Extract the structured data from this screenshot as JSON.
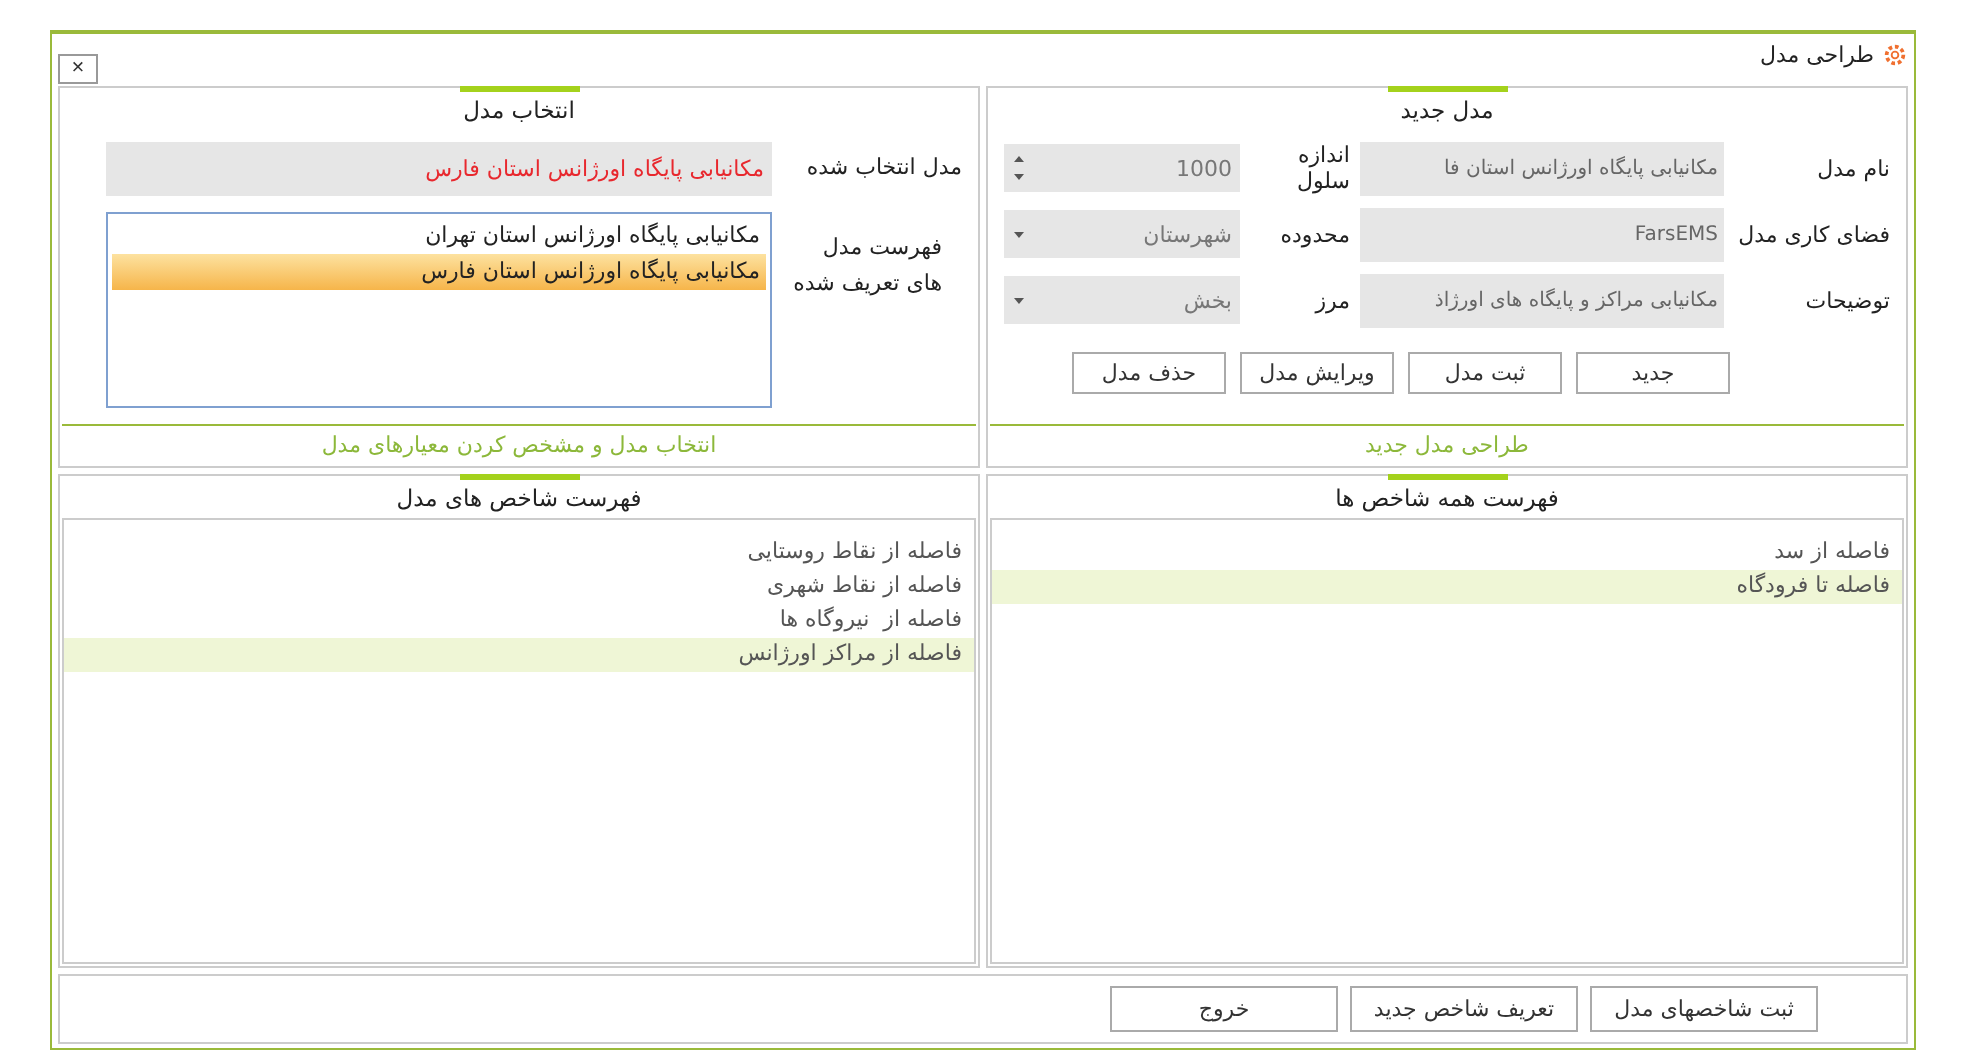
{
  "window": {
    "title": "طراحی مدل",
    "close": "×"
  },
  "new_model": {
    "title": "مدل جدید",
    "footer": "طراحی مدل جدید",
    "fields": [
      {
        "label": "نام مدل",
        "kind": "text",
        "value": "مکانیابی پایگاه اورژانس استان فا"
      },
      {
        "label": "اندازه سلول",
        "kind": "spinner",
        "value": "1000"
      },
      {
        "label": "فضای کاری مدل",
        "kind": "text",
        "value": "FarsEMS"
      },
      {
        "label": "محدوده",
        "kind": "dropdown",
        "value": "شهرستان"
      },
      {
        "label": "توضیحات",
        "kind": "text",
        "value": "مکانیابی مراکز و پایگاه های اورژاذ"
      },
      {
        "label": "مرز",
        "kind": "dropdown",
        "value": "بخش"
      }
    ],
    "buttons": [
      "جدید",
      "ثبت مدل",
      "ویرایش مدل",
      "حذف مدل"
    ]
  },
  "select_model": {
    "title": "انتخاب مدل",
    "footer": "انتخاب مدل و مشخص کردن معیارهای مدل",
    "selected_label": "مدل انتخاب شده",
    "selected_value": "مکانیابی پایگاه اورژانس استان فارس",
    "list_label": "فهرست مدل\nهای تعریف شده",
    "models": [
      {
        "name": "مکانیابی پایگاه اورژانس استان تهران",
        "selected": false
      },
      {
        "name": "مکانیابی پایگاه اورژانس استان فارس",
        "selected": true
      }
    ]
  },
  "all_indices": {
    "title": "فهرست همه شاخص ها",
    "items": [
      {
        "name": "فاصله از سد",
        "selected": false
      },
      {
        "name": "فاصله تا فرودگاه",
        "selected": true
      }
    ]
  },
  "model_indices": {
    "title": "فهرست شاخص های مدل",
    "items": [
      {
        "name": "فاصله از نقاط روستایی",
        "selected": false
      },
      {
        "name": "فاصله از نقاط شهری",
        "selected": false
      },
      {
        "name": "فاصله از  نیروگاه ها",
        "selected": false
      },
      {
        "name": "فاصله از مراکز اورژانس",
        "selected": true
      }
    ]
  },
  "footer_buttons": [
    "ثبت شاخصهای مدل",
    "تعریف شاخص جدید",
    "خروج"
  ]
}
